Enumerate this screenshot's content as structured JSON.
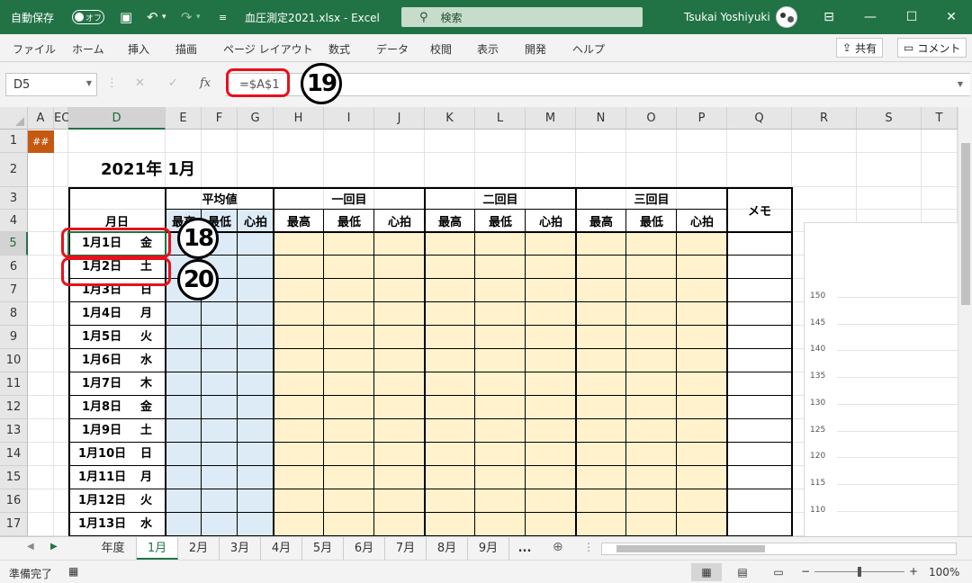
{
  "titlebar": {
    "autosave_label": "自動保存",
    "autosave_state": "オフ",
    "doc_title": "血圧測定2021.xlsx  -  Excel",
    "search_placeholder": "検索",
    "username": "Tsukai Yoshiyuki"
  },
  "ribbon": {
    "tabs": [
      "ファイル",
      "ホーム",
      "挿入",
      "描画",
      "ページ レイアウト",
      "数式",
      "データ",
      "校閲",
      "表示",
      "開発",
      "ヘルプ"
    ],
    "share_label": "共有",
    "comment_label": "コメント"
  },
  "formula_bar": {
    "name_box": "D5",
    "formula": "=$A$1",
    "fx": "fx"
  },
  "columns": [
    "A",
    "EC",
    "D",
    "E",
    "F",
    "G",
    "H",
    "I",
    "J",
    "K",
    "L",
    "M",
    "N",
    "O",
    "P",
    "Q",
    "R",
    "S",
    "T"
  ],
  "rows": [
    "1",
    "2",
    "3",
    "4",
    "5",
    "6",
    "7",
    "8",
    "9",
    "10",
    "11",
    "12",
    "13",
    "14",
    "15",
    "16",
    "17"
  ],
  "sheet": {
    "a1_value": "##",
    "title": "2021年 1月",
    "header_date": "月日",
    "header_avg": "平均値",
    "header_round1": "一回目",
    "header_round2": "二回目",
    "header_round3": "三回目",
    "header_memo": "メモ",
    "sub_headers": [
      "最高",
      "最低",
      "心拍",
      "最高",
      "最低",
      "心拍",
      "最高",
      "最低",
      "心拍",
      "最高",
      "最低",
      "心拍"
    ],
    "dates": [
      {
        "date": "1月1日",
        "weekday": "金"
      },
      {
        "date": "1月2日",
        "weekday": "土"
      },
      {
        "date": "1月3日",
        "weekday": "日"
      },
      {
        "date": "1月4日",
        "weekday": "月"
      },
      {
        "date": "1月5日",
        "weekday": "火"
      },
      {
        "date": "1月6日",
        "weekday": "水"
      },
      {
        "date": "1月7日",
        "weekday": "木"
      },
      {
        "date": "1月8日",
        "weekday": "金"
      },
      {
        "date": "1月9日",
        "weekday": "土"
      },
      {
        "date": "1月10日",
        "weekday": "日"
      },
      {
        "date": "1月11日",
        "weekday": "月"
      },
      {
        "date": "1月12日",
        "weekday": "火"
      },
      {
        "date": "1月13日",
        "weekday": "水"
      }
    ]
  },
  "chart": {
    "y_ticks": [
      "150",
      "145",
      "140",
      "135",
      "130",
      "125",
      "120",
      "115",
      "110"
    ]
  },
  "annotations": {
    "n18": "18",
    "n19": "19",
    "n20": "20"
  },
  "sheet_tabs": [
    "年度",
    "1月",
    "2月",
    "3月",
    "4月",
    "5月",
    "6月",
    "7月",
    "8月",
    "9月",
    "..."
  ],
  "active_sheet": "1月",
  "status": {
    "ready": "準備完了",
    "zoom": "100%"
  },
  "colors": {
    "excel_green": "#217346",
    "avg_fill": "#ddebf7",
    "entry_fill": "#fff2cc",
    "a1_fill": "#c65911",
    "annotation_red": "#e8101d"
  }
}
